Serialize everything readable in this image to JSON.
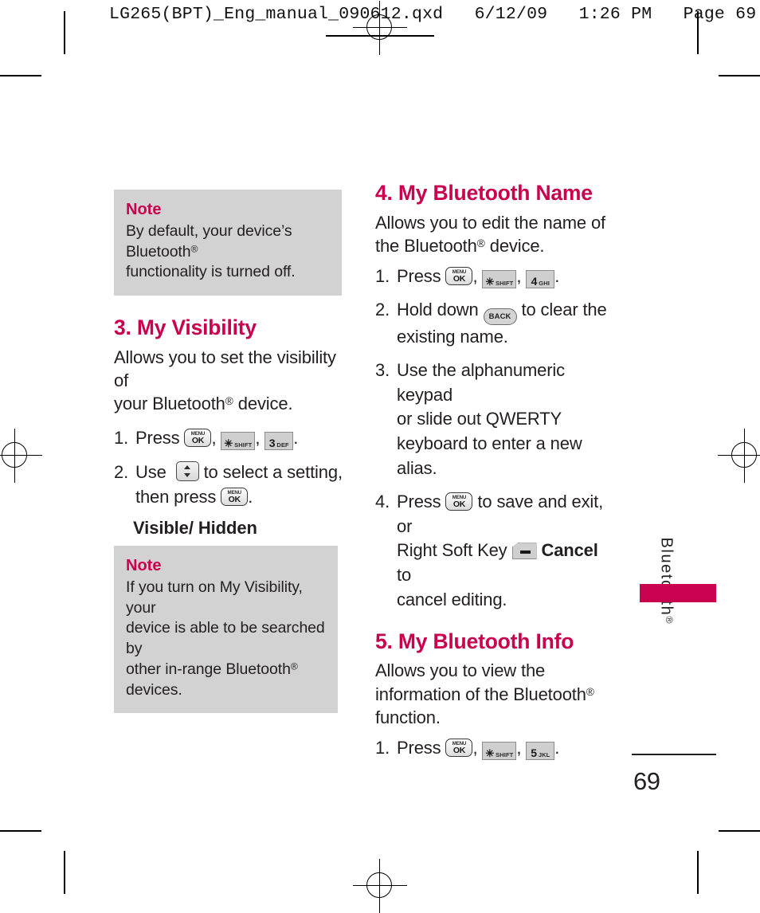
{
  "print_header": "LG265(BPT)_Eng_manual_090612.qxd   6/12/09   1:26 PM   Page 69",
  "colors": {
    "brand_crimson": "#c9024f",
    "note_gray": "#d2d2d2",
    "text": "#231f20"
  },
  "left_column": {
    "note_top": {
      "title": "Note",
      "body_line1": "By default, your device’s Bluetooth",
      "body_line2": "functionality is turned off."
    },
    "section": {
      "title": "3. My Visibility",
      "intro_line1": "Allows you to set the visibility of",
      "intro_line2": "your Bluetooth",
      "intro_line3": " device.",
      "steps": [
        {
          "num": "1.",
          "pre": "Press",
          "keys": [
            "menu-ok",
            "star-shift",
            "3-def"
          ],
          "post": "."
        },
        {
          "num": "2.",
          "pre": "Use",
          "mid": "to select a setting,",
          "line2_pre": "then press",
          "post": "."
        }
      ],
      "option_line": "Visible/ Hidden"
    },
    "note_bottom": {
      "title": "Note",
      "body_line1": "If you turn on My Visibility, your",
      "body_line2": "device is able to be searched by",
      "body_line3": "other in-range Bluetooth",
      "body_line4": " devices."
    }
  },
  "right_column": {
    "section4": {
      "title": "4. My Bluetooth Name",
      "intro_line1": "Allows you to edit the name of",
      "intro_line2": "the Bluetooth",
      "intro_line3": " device.",
      "steps": [
        {
          "num": "1.",
          "pre": "Press",
          "post": "."
        },
        {
          "num": "2.",
          "pre": "Hold down",
          "mid": "to clear the",
          "line2": "existing name."
        },
        {
          "num": "3.",
          "text_line1": "Use the alphanumeric keypad",
          "text_line2": "or slide out QWERTY",
          "text_line3": "keyboard to enter a new alias."
        },
        {
          "num": "4.",
          "pre": "Press",
          "mid": "to save and exit, or",
          "line2_pre": "Right Soft Key",
          "cancel": "Cancel",
          "line2_post": "to",
          "line3": "cancel editing."
        }
      ]
    },
    "section5": {
      "title": "5. My Bluetooth Info",
      "intro_line1": "Allows you to view the",
      "intro_line2": "information of the Bluetooth",
      "intro_line3": "function.",
      "steps": [
        {
          "num": "1.",
          "pre": "Press",
          "post": "."
        }
      ]
    }
  },
  "keys": {
    "menu_ok": {
      "top": "MENU",
      "bottom": "OK"
    },
    "star_shift": {
      "glyph": "✳",
      "label": "SHIFT"
    },
    "num3": {
      "digit": "3",
      "letters": "DEF"
    },
    "num4": {
      "digit": "4",
      "letters": "GHI"
    },
    "num5": {
      "digit": "5",
      "letters": "JKL"
    },
    "back": {
      "label": "BACK"
    },
    "nav_updown": {
      "name": "up-down-navigation-key"
    },
    "right_soft": {
      "name": "right-soft-key"
    }
  },
  "side_tab": {
    "label": "Bluetooth",
    "registered_mark": "®"
  },
  "folio": {
    "page_number": "69"
  }
}
